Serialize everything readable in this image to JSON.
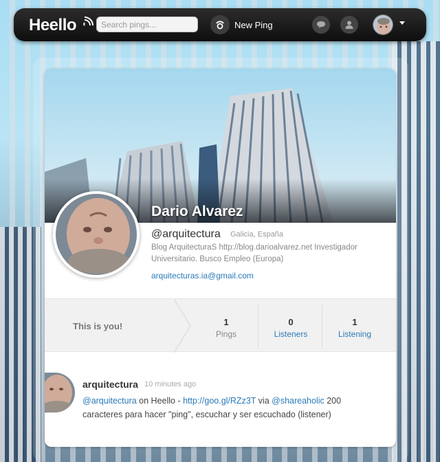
{
  "app": {
    "logo": "Heello"
  },
  "header": {
    "search_placeholder": "Search pings...",
    "new_ping_label": "New Ping"
  },
  "profile": {
    "name": "Dario Alvarez",
    "handle": "@arquitectura",
    "location": "Galicia, España",
    "bio": "Blog ArquitecturaS http://blog.darioalvarez.net Investigador Universitario. Busco Empleo (Europa)",
    "email": "arquitecturas.ia@gmail.com"
  },
  "stats": {
    "this_is_you": "This is you!",
    "pings": {
      "count": "1",
      "label": "Pings"
    },
    "listeners": {
      "count": "0",
      "label": "Listeners"
    },
    "listening": {
      "count": "1",
      "label": "Listening"
    }
  },
  "post": {
    "author": "arquitectura",
    "time": "10 minutes ago",
    "mention_1": "@arquitectura",
    "text_1": " on Heello - ",
    "link": "http://goo.gl/RZz3T",
    "text_2": " via ",
    "mention_2": "@shareaholic",
    "text_3": " 200 caracteres para hacer \"ping\", escuchar y ser escuchado (listener)"
  },
  "colors": {
    "link": "#2a7ab8",
    "topbar": "#1a1a1a",
    "stat_muted": "#888888"
  },
  "icons": [
    "heello-waves-icon",
    "ping-icon",
    "chat-bubble-icon",
    "user-icon",
    "caret-down-icon"
  ]
}
